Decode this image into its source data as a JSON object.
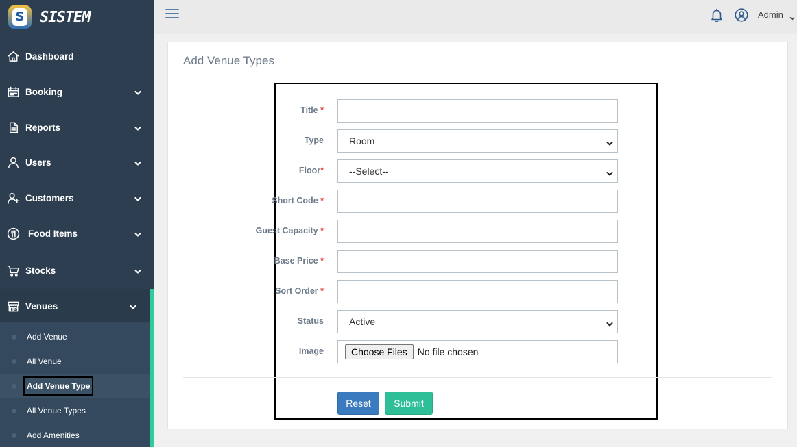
{
  "brand": {
    "logo_letter": "S",
    "name": "SISTEM"
  },
  "header": {
    "user_name": "Admin"
  },
  "sidebar": {
    "items": [
      {
        "label": "Dashboard",
        "icon": "home-icon"
      },
      {
        "label": "Booking",
        "icon": "calendar-icon"
      },
      {
        "label": "Reports",
        "icon": "document-icon"
      },
      {
        "label": "Users",
        "icon": "user-icon"
      },
      {
        "label": "Customers",
        "icon": "user-plus-icon"
      },
      {
        "label": "Food Items",
        "icon": "food-icon"
      },
      {
        "label": "Stocks",
        "icon": "cart-icon"
      },
      {
        "label": "Venues",
        "icon": "store-icon"
      }
    ],
    "venue_submenu": [
      {
        "label": "Add Venue"
      },
      {
        "label": "All Venue"
      },
      {
        "label": "Add Venue Type"
      },
      {
        "label": "All Venue Types"
      },
      {
        "label": "Add Amenities"
      }
    ]
  },
  "page": {
    "title": "Add Venue Types",
    "form": {
      "fields": [
        {
          "label": "Title",
          "required": "*",
          "value": ""
        },
        {
          "label": "Type",
          "required": "",
          "value": "Room"
        },
        {
          "label": "Floor",
          "required": "*",
          "value": "--Select--"
        },
        {
          "label": "Short Code",
          "required": "*",
          "value": ""
        },
        {
          "label": "Guest Capacity",
          "required": "*",
          "value": ""
        },
        {
          "label": "Base Price",
          "required": "*",
          "value": ""
        },
        {
          "label": "Sort Order",
          "required": "*",
          "value": ""
        },
        {
          "label": "Status",
          "required": "",
          "value": "Active"
        },
        {
          "label": "Image",
          "required": "",
          "button": "Choose Files",
          "value": "No file chosen"
        }
      ],
      "reset_label": "Reset",
      "submit_label": "Submit"
    }
  },
  "colors": {
    "sidebar_bg": "#2c3e50",
    "accent": "#2ecc9a",
    "reset_btn": "#3a7bbf",
    "submit_btn": "#2fbf98",
    "required": "#e0443a"
  }
}
